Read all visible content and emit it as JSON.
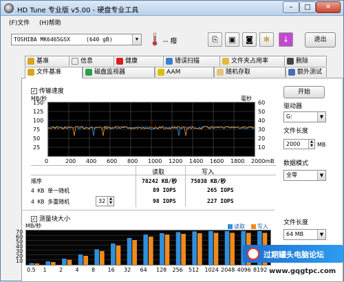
{
  "window": {
    "title": "HD Tune 专业版 v5.00 - 硬盘专业工具",
    "min": "–",
    "max": "□",
    "close": "✕"
  },
  "menu": {
    "file": "(F)文件",
    "help": "(H)帮助"
  },
  "toolbar": {
    "drive": "TOSHIBA MK6465GSX",
    "capacity": "(640 gB)",
    "temp": "-- 癈",
    "exit": "退出"
  },
  "tabs": {
    "row1": [
      "基准",
      "信息",
      "健康",
      "错误扫描",
      "文件夹占用率",
      "删除"
    ],
    "row2": [
      "文件基准",
      "磁盘监视器",
      "AAM",
      "随机存取",
      "额外测试"
    ]
  },
  "transfer": {
    "checkbox_label": "传输速度",
    "left_unit": "MB/秒",
    "right_unit": "毫秒",
    "y_left": [
      "150",
      "125",
      "100",
      "75",
      "50",
      "25"
    ],
    "y_right": [
      "60",
      "50",
      "40",
      "30",
      "20",
      "10"
    ],
    "x_ticks": [
      "0",
      "200",
      "400",
      "600",
      "800",
      "1000",
      "1200",
      "1400",
      "1600",
      "1800",
      "2000mB"
    ]
  },
  "results": {
    "col_read": "读取",
    "col_write": "写入",
    "rows": [
      {
        "label": "顺序",
        "read": "78242 KB/秒",
        "write": "75038 KB/秒"
      },
      {
        "label": "4 KB 单一随机",
        "read": "89 IOPS",
        "write": "265 IOPS"
      },
      {
        "label": "4 KB 多重随机",
        "queue": "32",
        "read": "98 IOPS",
        "write": "227 IOPS"
      }
    ]
  },
  "block": {
    "checkbox_label": "测量块大小",
    "unit": "MB/秒",
    "legend_read": "读取",
    "legend_write": "写入",
    "y": [
      "70",
      "60",
      "50",
      "40",
      "30",
      "20",
      "10"
    ],
    "x": [
      "0.5",
      "1",
      "2",
      "4",
      "8",
      "16",
      "32",
      "64",
      "128",
      "256",
      "512",
      "1024",
      "2048",
      "4096",
      "8192"
    ]
  },
  "right": {
    "start": "开始",
    "drive_label": "驱动器",
    "drive_value": "G:",
    "file_len_label": "文件长度",
    "file_len_value": "2000",
    "file_len_unit": "MB",
    "data_mode_label": "数据模式",
    "data_mode_value": "全零",
    "file_len2_label": "文件长度",
    "file_len2_value": "64 MB"
  },
  "watermark": {
    "text": "过期罐头电脑论坛",
    "url": "www.gqgtpc.com"
  },
  "colors": {
    "read": "#2f8fdc",
    "write": "#f08a1c",
    "chart_bg": "#000000",
    "grid": "#5a5a5a",
    "title_grad_top": "#dce9f7"
  }
}
